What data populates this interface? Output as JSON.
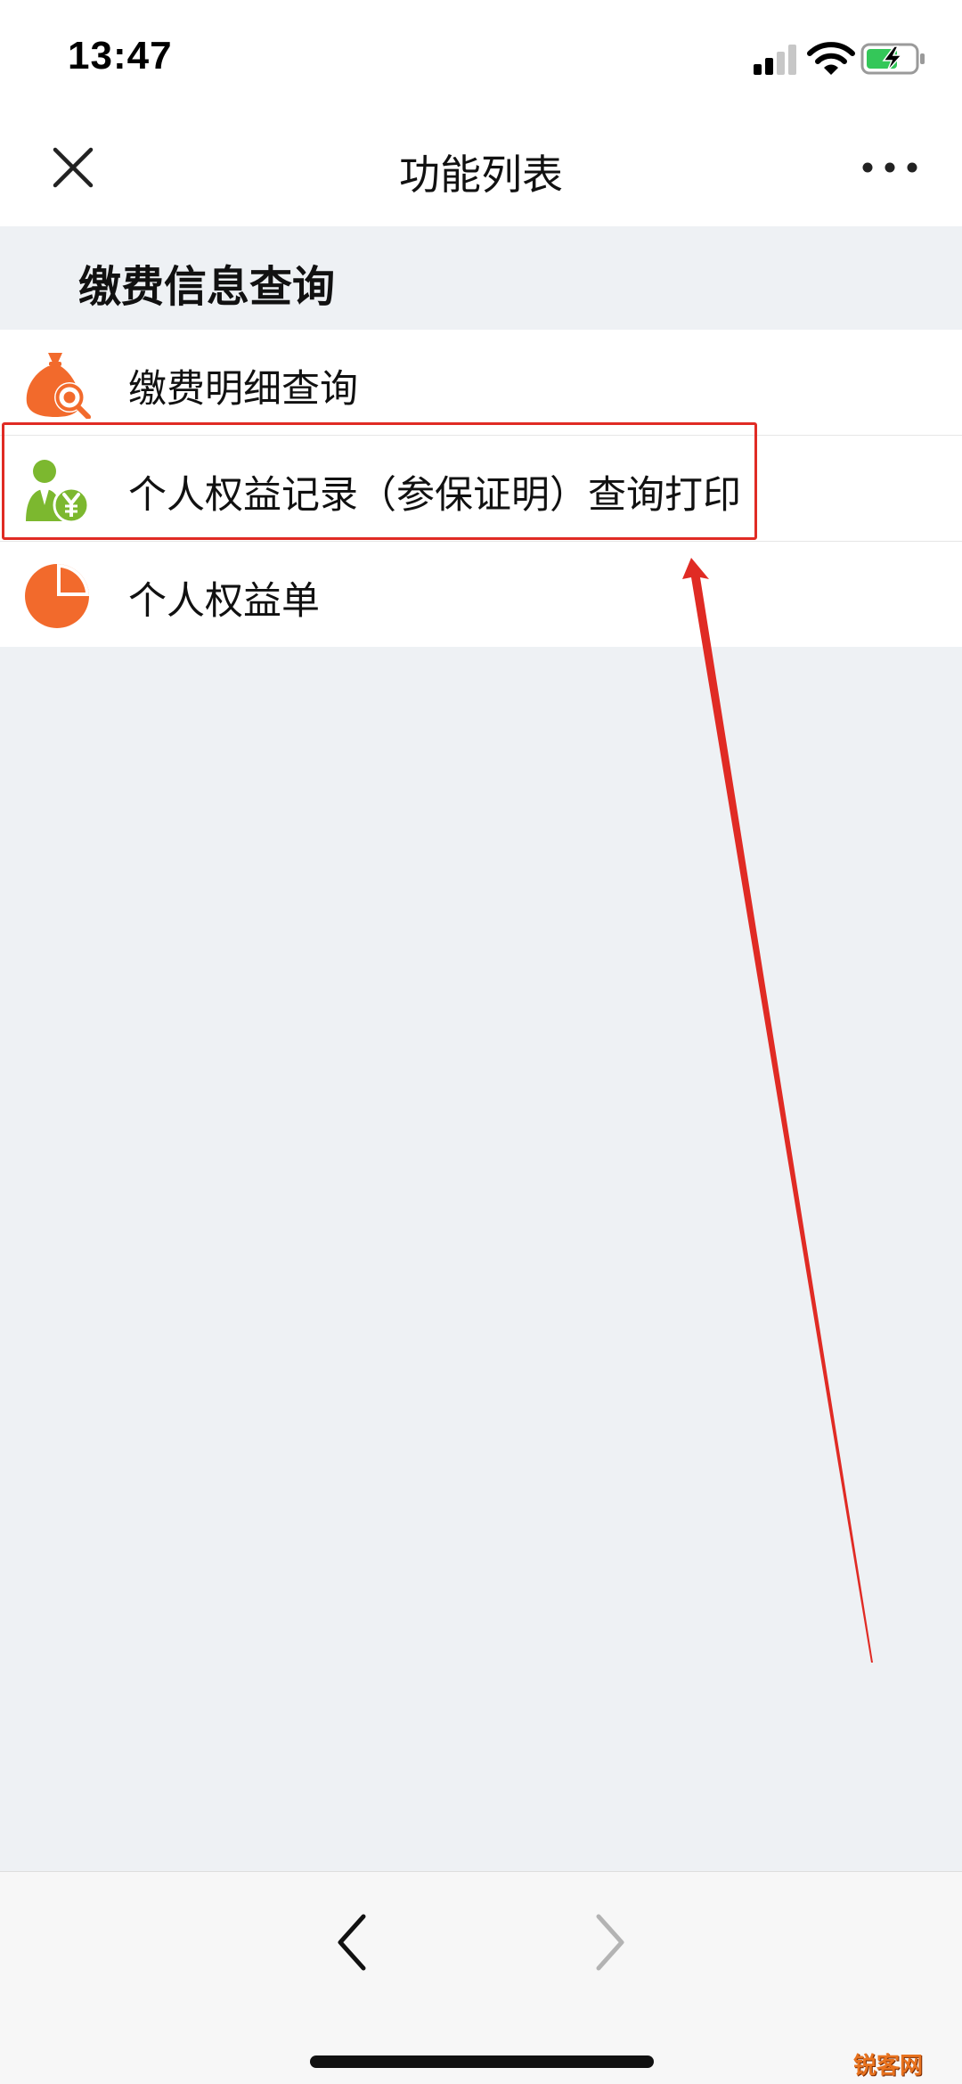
{
  "status_bar": {
    "time": "13:47"
  },
  "nav": {
    "title": "功能列表"
  },
  "section": {
    "title": "缴费信息查询"
  },
  "menu": {
    "items": [
      {
        "label": "缴费明细查询",
        "icon": "money-bag-icon"
      },
      {
        "label": "个人权益记录（参保证明）查询打印",
        "icon": "person-yen-icon"
      },
      {
        "label": "个人权益单",
        "icon": "pie-chart-icon"
      }
    ]
  },
  "colors": {
    "accent_orange": "#f26a2c",
    "accent_green": "#7cb82f",
    "annotation_red": "#e02b24",
    "background": "#eef1f4"
  },
  "watermark": "锐客网"
}
